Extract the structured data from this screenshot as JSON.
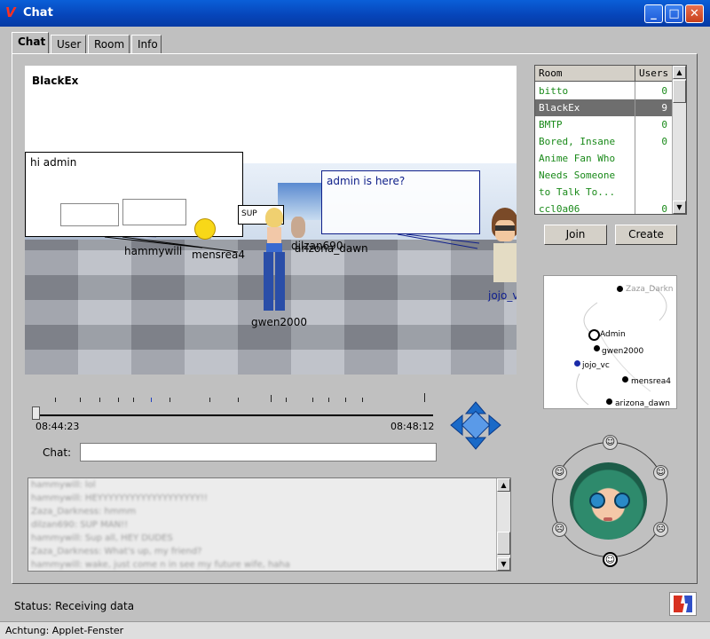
{
  "window": {
    "title": "Chat",
    "minimize_label": "_",
    "maximize_label": "□",
    "close_label": "✕"
  },
  "tabs": [
    {
      "label": "Chat",
      "active": true
    },
    {
      "label": "User"
    },
    {
      "label": "Room"
    },
    {
      "label": "Info"
    }
  ],
  "scene": {
    "room_title": "BlackEx",
    "bubbles": [
      "hi admin",
      "admin is here?"
    ],
    "sign_text": "SUP",
    "avatars": [
      "hammywill",
      "mensrea4",
      "dilzan690",
      "arizona_dawn",
      "gwen2000",
      "jojo_vc"
    ]
  },
  "timeline": {
    "start": "08:44:23",
    "end": "08:48:12",
    "position": 0.0
  },
  "chat": {
    "label": "Chat:",
    "input_value": ""
  },
  "log": {
    "lines": [
      "hammywill: lol",
      "hammywill: HEYYYYYYYYYYYYYYYYYYY!!",
      "Zaza_Darkness: hmmm",
      "dilzan690: SUP MAN!!",
      "hammywill: Sup all, HEY DUDES",
      "Zaza_Darkness: What's up, my friend?",
      "hammywill: wake, just come n in see my future wife, haha"
    ]
  },
  "rooms": {
    "header_room": "Room",
    "header_users": "Users",
    "rows": [
      {
        "name": "bitto",
        "users": "0"
      },
      {
        "name": "BlackEx",
        "users": "9",
        "selected": true
      },
      {
        "name": "BMTP",
        "users": "0"
      },
      {
        "name": "Bored, Insane",
        "users": "0"
      },
      {
        "name": "Anime Fan Who",
        "users": ""
      },
      {
        "name": "Needs Someone",
        "users": ""
      },
      {
        "name": "to Talk To...",
        "users": ""
      },
      {
        "name": "ccl0a06",
        "users": "0"
      }
    ],
    "join_label": "Join",
    "create_label": "Create"
  },
  "map": {
    "labels": [
      "Zaza_Darkn",
      "Admin",
      "gwen2000",
      "jojo_vc",
      "mensrea4",
      "arizona_dawn"
    ]
  },
  "status": {
    "text": "Status: Receiving data"
  },
  "applet": {
    "text": "Achtung: Applet-Fenster"
  },
  "colors": {
    "title_bar": "#0644b8",
    "room_text": "#1a8a1a",
    "selected_row": "#6e6e6e",
    "arrow_blue": "#1a6ac8"
  }
}
